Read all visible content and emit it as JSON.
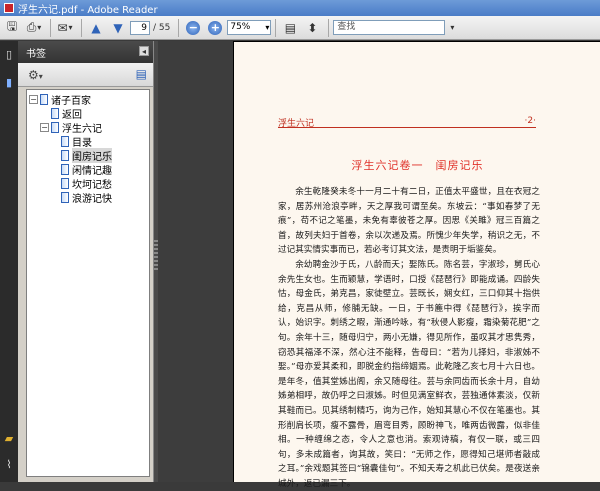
{
  "window": {
    "title": "浮生六记.pdf - Adobe Reader"
  },
  "toolbar": {
    "current_page": "9",
    "page_total": "/ 55",
    "zoom": "75%",
    "search_placeholder": "查找"
  },
  "bookmarks": {
    "header": "书签",
    "close_glyph": "◂",
    "items": [
      {
        "label": "诸子百家"
      },
      {
        "label": "返回"
      },
      {
        "label": "浮生六记"
      },
      {
        "label": "目录"
      },
      {
        "label": "闺房记乐"
      },
      {
        "label": "闲情记趣"
      },
      {
        "label": "坎坷记愁"
      },
      {
        "label": "浪游记快"
      }
    ]
  },
  "document": {
    "running_head_left": "浮生六记",
    "running_head_right": "·2·",
    "chapter_title": "浮生六记卷一　闺房记乐",
    "paragraphs": [
      "余生乾隆癸未冬十一月二十有二日，正值太平盛世，且在衣冠之家，居苏州沧浪亭畔，天之厚我可谓至矣。东坡云：“事如春梦了无痕”，苟不记之笔墨，未免有辜彼苍之厚。因思《关雎》冠三百篇之首，故列夫妇于首卷，余以次递及焉。所愧少年失学，稍识之无，不过记其实情实事而已，若必考订其文法，是责明于垢鉴矣。",
      "余幼聘金沙于氏，八龄而夭；娶陈氏。陈名芸，字淑珍，舅氏心余先生女也。生而颖慧，学语时，口授《琵琶行》即能成诵。四龄失怙，母金氏，弟克昌，家徒壁立。芸既长，娴女红，三口仰其十指供给，克昌从师，修脯无缺。一日，于书簏中得《琵琶行》，挨字而认，始识字。刺绣之暇，渐通吟咏，有“秋侵人影瘦，霜染菊花肥”之句。余年十三，随母归宁，两小无嫌，得见所作，虽叹其才思隽秀，窃恐其福泽不深，然心注不能释，告母曰：“若为儿择妇，非淑姊不娶。”母亦爱其柔和，即脱金约指缔姻焉。此乾隆乙亥七月十六日也。是年冬，值其堂姊出阁，余又随母往。芸与余同齿而长余十月，自幼姊弟相呼，故仍呼之曰淑姊。时但见满室鲜衣，芸独通体素淡，仅新其鞋而已。见其绣制精巧，询为己作，始知其慧心不仅在笔墨也。其形削肩长项，瘦不露骨，眉弯目秀，顾盼神飞，唯两齿微露，似非佳相。一种缠绵之态，令人之意也消。索观诗稿，有仅一联，或三四句，多未成篇者，询其故，笑曰：“无师之作，愿得知己堪师者敲成之耳。”余戏题其签曰“锦囊佳句”。不知夭寿之机此已伏矣。是夜送亲城外，返已漏三下。"
    ]
  }
}
